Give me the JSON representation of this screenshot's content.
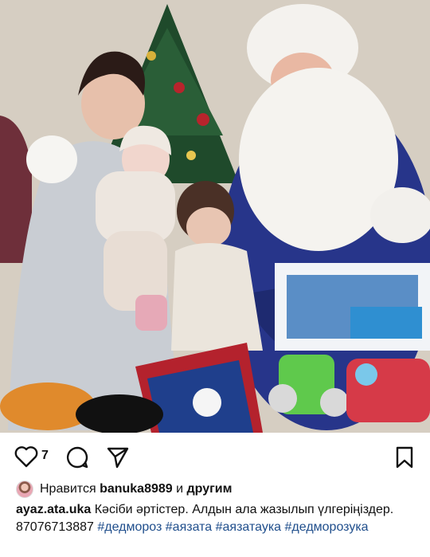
{
  "post": {
    "image_alt": "Family photo with Ded Moroz next to a Christmas tree",
    "like_count": "7",
    "liked_by_prefix": "Нравится",
    "liked_by_user": "banuka8989",
    "liked_by_and": "и",
    "liked_by_others": "другим",
    "caption_user": "ayaz.ata.uka",
    "caption_text": "Кәсіби әртістер. Алдын ала жазылып үлгеріңіздер. 87076713887",
    "hashtags": [
      "#дедмороз",
      "#аязата",
      "#аязатаука",
      "#дедморозука"
    ]
  },
  "icons": {
    "like": "heart-icon",
    "comment": "comment-icon",
    "share": "send-icon",
    "save": "bookmark-icon"
  },
  "colors": {
    "hashtag": "#1f4e8c",
    "text": "#111111"
  }
}
